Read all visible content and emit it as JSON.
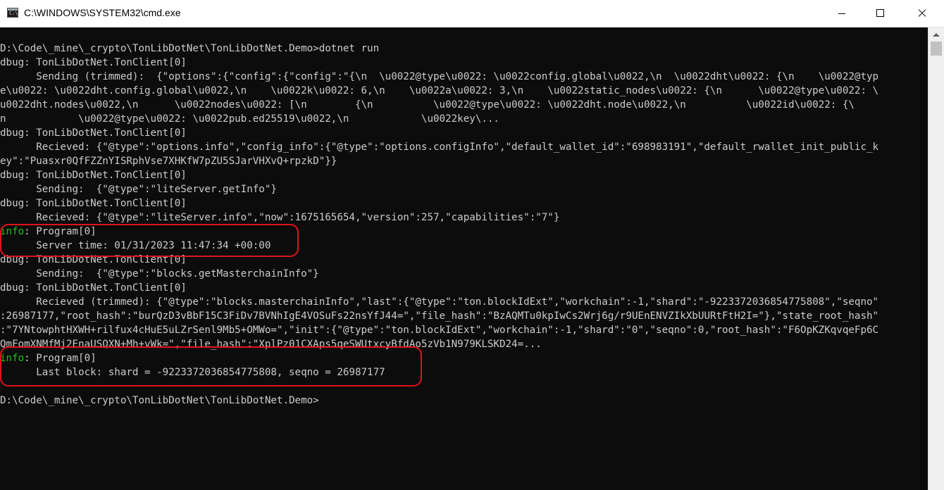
{
  "window": {
    "title": "C:\\WINDOWS\\SYSTEM32\\cmd.exe",
    "icon_text": "C:\\"
  },
  "console": {
    "lines": [
      "",
      "D:\\Code\\_mine\\_crypto\\TonLibDotNet\\TonLibDotNet.Demo>dotnet run",
      "dbug: TonLibDotNet.TonClient[0]",
      "      Sending (trimmed):  {\"options\":{\"config\":{\"config\":\"{\\n  \\u0022@type\\u0022: \\u0022config.global\\u0022,\\n  \\u0022dht\\u0022: {\\n    \\u0022@typ",
      "e\\u0022: \\u0022dht.config.global\\u0022,\\n    \\u0022k\\u0022: 6,\\n    \\u0022a\\u0022: 3,\\n    \\u0022static_nodes\\u0022: {\\n      \\u0022@type\\u0022: \\",
      "u0022dht.nodes\\u0022,\\n      \\u0022nodes\\u0022: [\\n        {\\n          \\u0022@type\\u0022: \\u0022dht.node\\u0022,\\n          \\u0022id\\u0022: {\\",
      "n            \\u0022@type\\u0022: \\u0022pub.ed25519\\u0022,\\n            \\u0022key\\...",
      "dbug: TonLibDotNet.TonClient[0]",
      "      Recieved: {\"@type\":\"options.info\",\"config_info\":{\"@type\":\"options.configInfo\",\"default_wallet_id\":\"698983191\",\"default_rwallet_init_public_k",
      "ey\":\"Puasxr0QfFZZnYISRphVse7XHKfW7pZU5SJarVHXvQ+rpzkD\"}}",
      "dbug: TonLibDotNet.TonClient[0]",
      "      Sending:  {\"@type\":\"liteServer.getInfo\"}",
      "dbug: TonLibDotNet.TonClient[0]",
      "      Recieved: {\"@type\":\"liteServer.info\",\"now\":1675165654,\"version\":257,\"capabilities\":\"7\"}",
      "info: Program[0]",
      "      Server time: 01/31/2023 11:47:34 +00:00",
      "dbug: TonLibDotNet.TonClient[0]",
      "      Sending:  {\"@type\":\"blocks.getMasterchainInfo\"}",
      "dbug: TonLibDotNet.TonClient[0]",
      "      Recieved (trimmed): {\"@type\":\"blocks.masterchainInfo\",\"last\":{\"@type\":\"ton.blockIdExt\",\"workchain\":-1,\"shard\":\"-9223372036854775808\",\"seqno\"",
      ":26987177,\"root_hash\":\"burQzD3vBbF15C3FiDv7BVNhIgE4VOSuFs22nsYfJ44=\",\"file_hash\":\"BzAQMTu0kpIwCs2Wrj6g/r9UEnENVZIkXbUURtFtH2I=\"},\"state_root_hash\"",
      ":\"7YNtowphtHXWH+rilfux4cHuE5uLZrSenl9Mb5+OMWo=\",\"init\":{\"@type\":\"ton.blockIdExt\",\"workchain\":-1,\"shard\":\"0\",\"seqno\":0,\"root_hash\":\"F6OpKZKqvqeFp6C",
      "QmFomXNMfMj2EnaUSQXN+Mh+vWk=\",\"file_hash\":\"XplPz01CXAps5qeSWUtxcyBfdAo5zVb1N979KLSKD24=...",
      "info: Program[0]",
      "      Last block: shard = -9223372036854775808, seqno = 26987177",
      "",
      "D:\\Code\\_mine\\_crypto\\TonLibDotNet\\TonLibDotNet.Demo>"
    ],
    "colors": {
      "background": "#0c0c0c",
      "text": "#cccccc",
      "info": "#16c60c",
      "annotation": "#e0121b"
    }
  }
}
